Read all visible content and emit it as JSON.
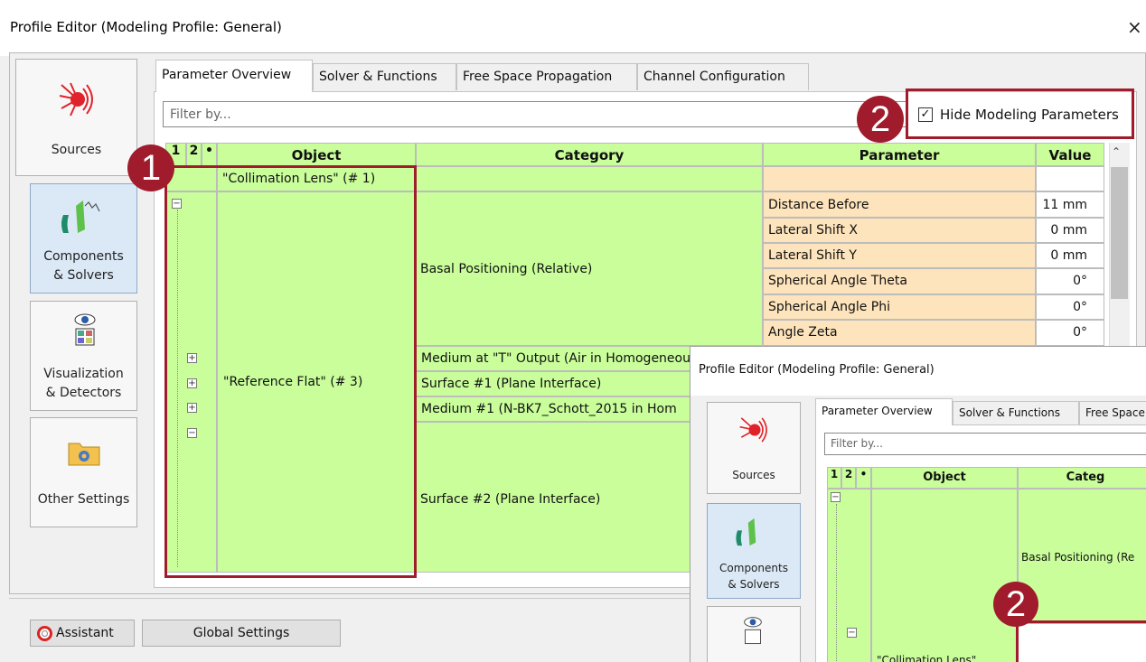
{
  "window": {
    "title": "Profile Editor (Modeling Profile: General)",
    "close_glyph": "×"
  },
  "nav": {
    "items": [
      {
        "label": "Sources",
        "icon": "sources-icon"
      },
      {
        "label_line1": "Components",
        "label_line2": "& Solvers",
        "icon": "components-solvers-icon"
      },
      {
        "label_line1": "Visualization",
        "label_line2": "& Detectors",
        "icon": "visualization-detectors-icon"
      },
      {
        "label": "Other Settings",
        "icon": "other-settings-icon"
      }
    ]
  },
  "tabs": [
    "Parameter Overview",
    "Solver & Functions",
    "Free Space Propagation",
    "Channel Configuration"
  ],
  "filter": {
    "placeholder": "Filter by..."
  },
  "hide_modeling": {
    "label": "Hide Modeling Parameters",
    "checked": true
  },
  "table": {
    "headers": {
      "c1": "1",
      "c2": "2",
      "star": "•",
      "object": "Object",
      "category": "Category",
      "parameter": "Parameter",
      "value": "Value"
    },
    "objects": {
      "collimation": "\"Collimation Lens\" (# 1)",
      "reference": "\"Reference Flat\" (# 3)"
    },
    "categories": {
      "basal": "Basal Positioning (Relative)",
      "medium_t": "Medium at \"T\" Output (Air in Homogeneous",
      "surface1": "Surface #1 (Plane Interface)",
      "medium1": "Medium #1 (N-BK7_Schott_2015 in Hom",
      "surface2": "Surface #2 (Plane Interface)"
    },
    "parameters": [
      {
        "name": "Distance Before",
        "value": "11 mm"
      },
      {
        "name": "Lateral Shift X",
        "value": "0 mm"
      },
      {
        "name": "Lateral Shift Y",
        "value": "0 mm"
      },
      {
        "name": "Spherical Angle Theta",
        "value": "0°"
      },
      {
        "name": "Spherical Angle Phi",
        "value": "0°"
      },
      {
        "name": "Angle Zeta",
        "value": "0°"
      }
    ]
  },
  "badges": {
    "one": "1",
    "two": "2"
  },
  "bottom": {
    "assistant": "Assistant",
    "global": "Global Settings"
  },
  "inset": {
    "title": "Profile Editor (Modeling Profile: General)",
    "tabs": [
      "Parameter Overview",
      "Solver & Functions",
      "Free Space"
    ],
    "filter_placeholder": "Filter by...",
    "nav": {
      "sources": "Sources",
      "comp1": "Components",
      "comp2": "& Solvers"
    },
    "headers": {
      "c1": "1",
      "c2": "2",
      "star": "•",
      "object": "Object",
      "category": "Categ"
    },
    "category": "Basal Positioning (Re",
    "object": "\"Collimation Lens\"",
    "badge": "2"
  },
  "colors": {
    "accent_red": "#a01c2c",
    "grid_green": "#c9fe9b",
    "grid_peach": "#fee4bc",
    "nav_active": "#dbe8f6"
  }
}
